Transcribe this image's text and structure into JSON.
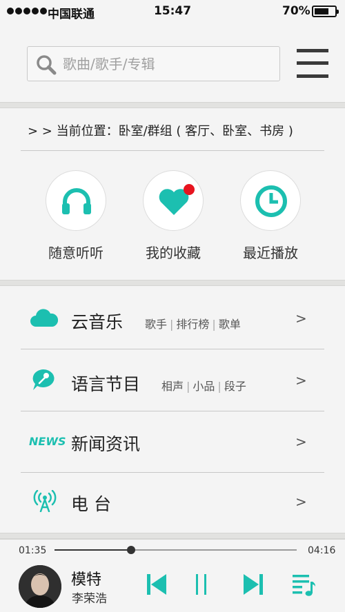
{
  "status_bar": {
    "carrier": "中国联通",
    "time": "15:47",
    "battery_percent": "70%",
    "battery_level": 0.7
  },
  "search": {
    "placeholder": "歌曲/歌手/专辑",
    "value": "",
    "icon": "search-icon"
  },
  "menu_icon": "hamburger-menu-icon",
  "location": {
    "text": "> > 当前位置：卧室/群组 ( 客厅、卧室、书房 )"
  },
  "shortcuts": [
    {
      "label": "随意听听",
      "icon": "headphones-icon"
    },
    {
      "label": "我的收藏",
      "icon": "heart-icon",
      "badge": true
    },
    {
      "label": "最近播放",
      "icon": "clock-icon"
    }
  ],
  "menu": [
    {
      "title": "云音乐",
      "icon": "cloud-icon",
      "subitems": [
        "歌手",
        "排行榜",
        "歌单"
      ],
      "chevron": ">"
    },
    {
      "title": "语言节目",
      "icon": "microphone-chat-icon",
      "subitems": [
        "相声",
        "小品",
        "段子"
      ],
      "chevron": ">"
    },
    {
      "title": "新闻资讯",
      "icon": "news-icon",
      "icon_text": "NEWS",
      "subitems": [],
      "chevron": ">"
    },
    {
      "title": "电 台",
      "icon": "radio-antenna-icon",
      "subitems": [],
      "chevron": ">"
    }
  ],
  "player": {
    "current_time": "01:35",
    "total_time": "04:16",
    "progress": 0.316,
    "song_title": "模特",
    "artist": "李荣浩",
    "controls": [
      "previous-icon",
      "pause-icon",
      "next-icon",
      "playlist-icon"
    ]
  },
  "colors": {
    "accent": "#1cbfb0",
    "badge": "#e7141f",
    "background": "#f4f4f4"
  }
}
